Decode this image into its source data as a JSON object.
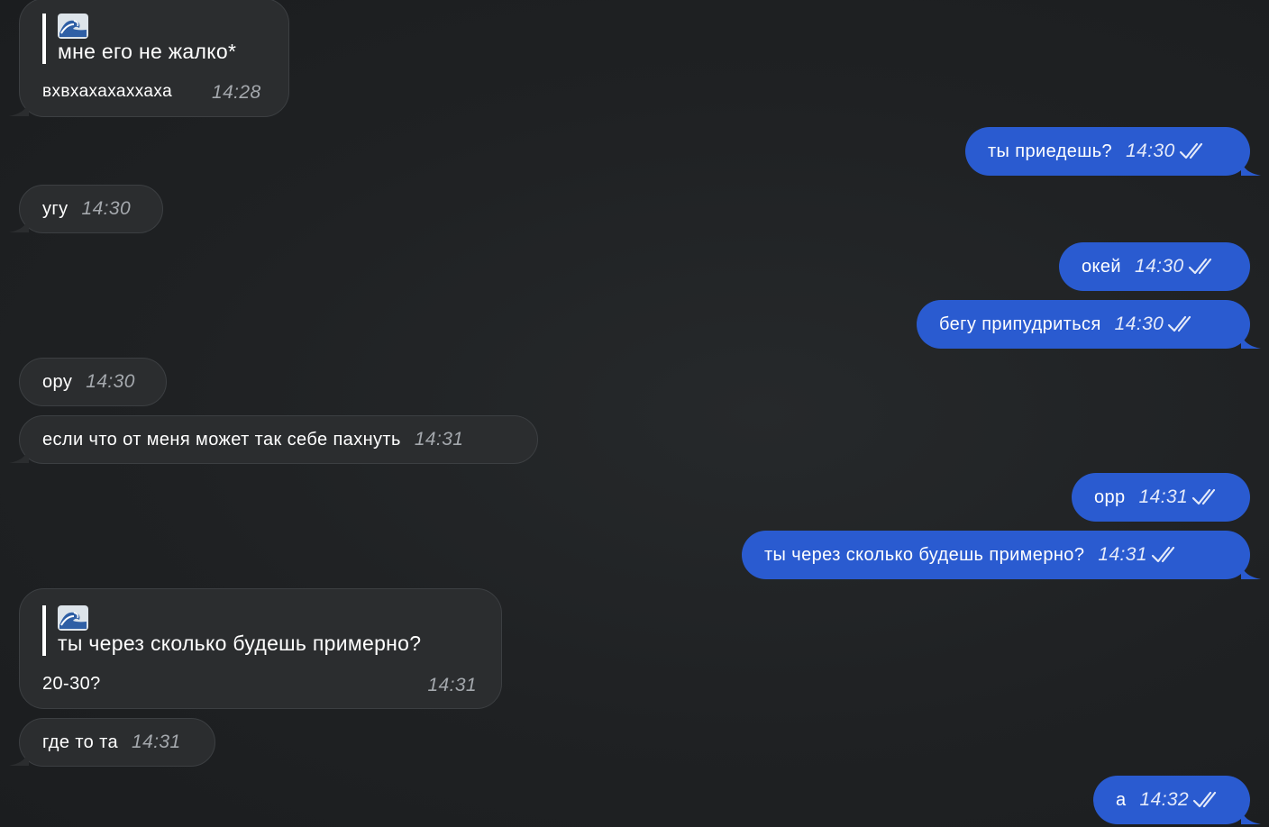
{
  "messages": [
    {
      "quote_text": "мне его не жалко*",
      "quote_icon": "wave-emoji-icon",
      "text": "вхвхахахаххаха",
      "time": "14:28"
    },
    {
      "text": "ты приедешь?",
      "time": "14:30"
    },
    {
      "text": "угу",
      "time": "14:30"
    },
    {
      "text": "окей",
      "time": "14:30"
    },
    {
      "text": "бегу припудриться",
      "time": "14:30"
    },
    {
      "text": "ору",
      "time": "14:30"
    },
    {
      "text": "если что от меня может так себе пахнуть",
      "time": "14:31"
    },
    {
      "text": "орр",
      "time": "14:31"
    },
    {
      "text": "ты через сколько будешь примерно?",
      "time": "14:31"
    },
    {
      "quote_text": "ты через сколько будешь примерно?",
      "quote_icon": "wave-emoji-icon",
      "text": "20-30?",
      "time": "14:31"
    },
    {
      "text": "где то та",
      "time": "14:31"
    },
    {
      "text": "а",
      "time": "14:32"
    }
  ],
  "colors": {
    "background": "#1e2022",
    "incoming_bubble": "#2b2d2f",
    "outgoing_bubble": "#2a5bd0",
    "text": "#ffffff"
  },
  "icons": {
    "read_receipt": "double-check-icon",
    "quote": "wave-emoji-icon"
  }
}
